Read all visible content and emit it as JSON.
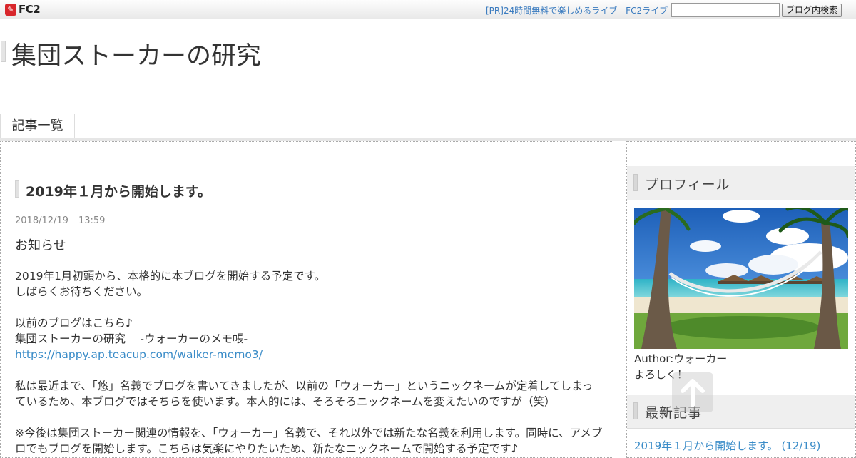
{
  "topbar": {
    "logo_text": "FC2",
    "pr_link": "[PR]24時間無料で楽しめるライブ - FC2ライブ",
    "search_value": "",
    "search_button": "ブログ内検索"
  },
  "header": {
    "blog_title": "集団ストーカーの研究"
  },
  "nav": {
    "items": [
      {
        "label": "記事一覧"
      }
    ]
  },
  "entry": {
    "title": "2019年１月から開始します。",
    "date": "2018/12/19",
    "time": "13:59",
    "category": "お知らせ",
    "paragraphs": [
      "2019年1月初頭から、本格的に本ブログを開始する予定です。\nしばらくお待ちください。",
      "以前のブログはこちら♪\n集団ストーカーの研究　 -ウォーカーのメモ帳-",
      "https://happy.ap.teacup.com/walker-memo3/",
      "私は最近まで、「悠」名義でブログを書いてきましたが、以前の「ウォーカー」というニックネームが定着してしまっているため、本ブログではそちらを使います。本人的には、そろそろニックネームを変えたいのですが（笑）",
      "※今後は集団ストーカー関連の情報を、「ウォーカー」名義で、それ以外では新たな名義を利用します。同時に、アメブロでもブログを開始します。こちらは気楽にやりたいため、新たなニックネームで開始する予定です♪"
    ]
  },
  "sidebar": {
    "profile_heading": "プロフィール",
    "author": "Author:ウォーカー",
    "greeting": "よろしく！",
    "recent_heading": "最新記事",
    "recent_items": [
      {
        "label": "2019年１月から開始します。 (12/19)"
      }
    ]
  },
  "colors": {
    "link": "#3a8cc8",
    "fc2_red": "#d8262b",
    "heading_bg": "#efefef"
  }
}
